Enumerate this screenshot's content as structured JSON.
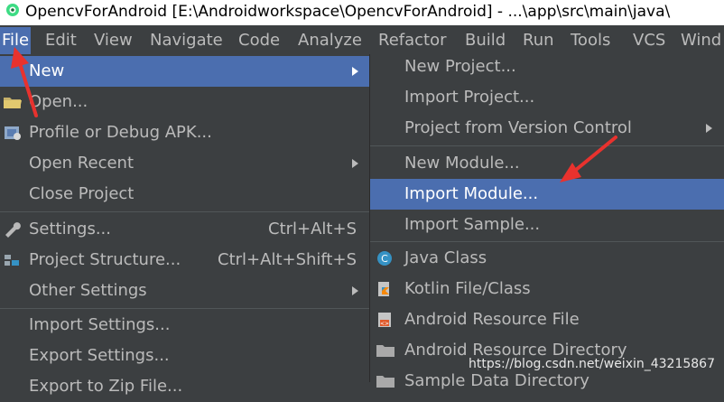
{
  "window": {
    "title": "OpencvForAndroid [E:\\Androidworkspace\\OpencvForAndroid] - ...\\app\\src\\main\\java\\"
  },
  "menubar": {
    "items": [
      {
        "label": "File"
      },
      {
        "label": "Edit"
      },
      {
        "label": "View"
      },
      {
        "label": "Navigate"
      },
      {
        "label": "Code"
      },
      {
        "label": "Analyze"
      },
      {
        "label": "Refactor"
      },
      {
        "label": "Build"
      },
      {
        "label": "Run"
      },
      {
        "label": "Tools"
      },
      {
        "label": "VCS"
      },
      {
        "label": "Wind"
      }
    ]
  },
  "file_menu": {
    "items": [
      {
        "label": "New",
        "icon": "none",
        "submenu": true,
        "highlighted": true
      },
      {
        "label": "Open...",
        "icon": "folder-icon"
      },
      {
        "label": "Profile or Debug APK...",
        "icon": "apk-debug-icon"
      },
      {
        "label": "Open Recent",
        "submenu": true
      },
      {
        "label": "Close Project"
      },
      {
        "label": "Settings...",
        "icon": "wrench-icon",
        "shortcut": "Ctrl+Alt+S"
      },
      {
        "label": "Project Structure...",
        "icon": "project-structure-icon",
        "shortcut": "Ctrl+Alt+Shift+S"
      },
      {
        "label": "Other Settings",
        "submenu": true
      },
      {
        "label": "Import Settings..."
      },
      {
        "label": "Export Settings..."
      },
      {
        "label": "Export to Zip File..."
      }
    ]
  },
  "new_submenu": {
    "items": [
      {
        "label": "New Project..."
      },
      {
        "label": "Import Project..."
      },
      {
        "label": "Project from Version Control",
        "submenu": true
      },
      {
        "label": "New Module..."
      },
      {
        "label": "Import Module...",
        "highlighted": true
      },
      {
        "label": "Import Sample..."
      },
      {
        "label": "Java Class",
        "icon": "java-class-icon"
      },
      {
        "label": "Kotlin File/Class",
        "icon": "kotlin-icon"
      },
      {
        "label": "Android Resource File",
        "icon": "android-resource-file-icon"
      },
      {
        "label": "Android Resource Directory",
        "icon": "folder-icon"
      },
      {
        "label": "Sample Data Directory",
        "icon": "folder-icon"
      }
    ]
  },
  "watermark": "https://blog.csdn.net/weixin_43215867",
  "colors": {
    "menu_bg": "#3c3f41",
    "highlight": "#4b6eaf",
    "text": "#bbbbbb",
    "annotation": "#e8322e"
  }
}
